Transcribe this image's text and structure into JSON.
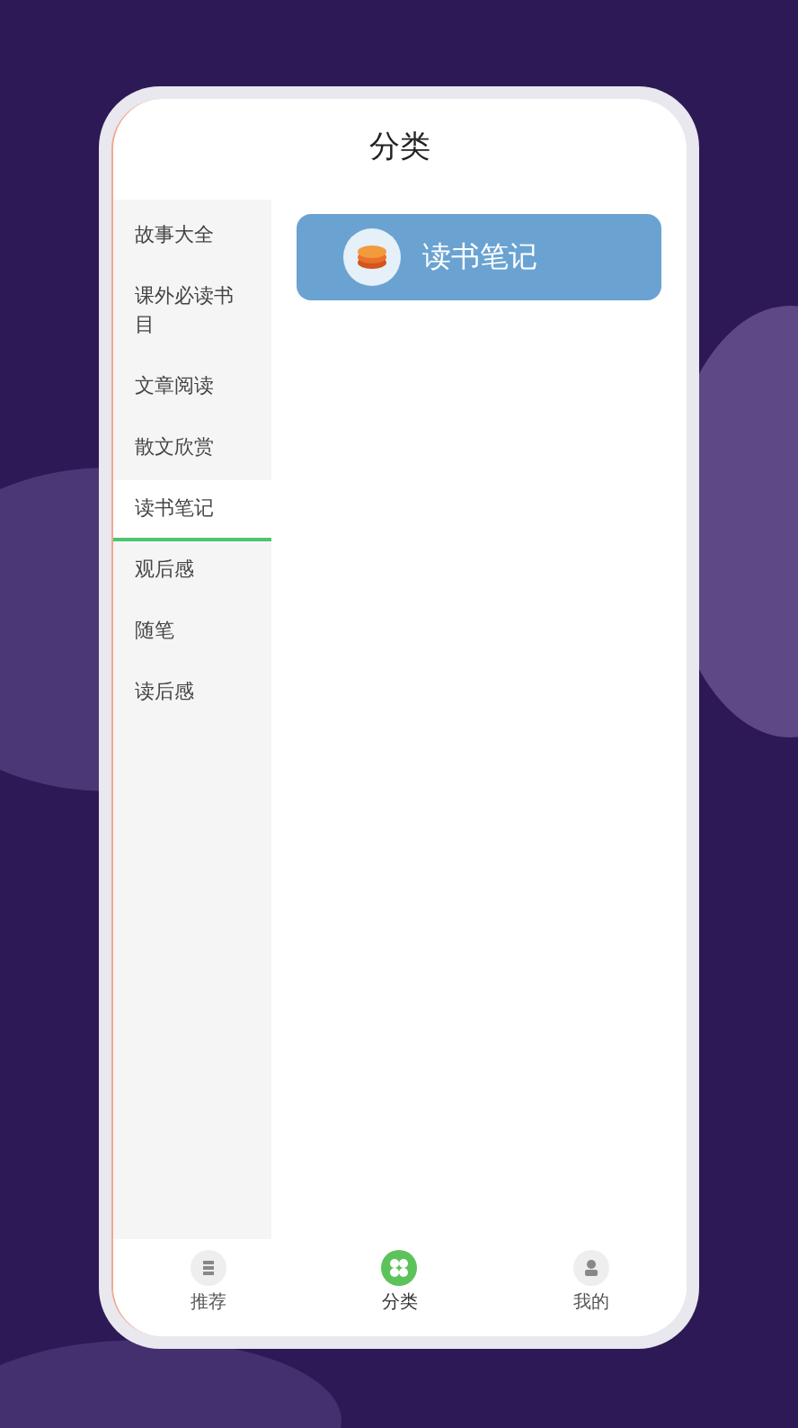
{
  "header": {
    "title": "分类"
  },
  "categories": [
    {
      "label": "故事大全",
      "selected": false
    },
    {
      "label": "课外必读书目",
      "selected": false
    },
    {
      "label": "文章阅读",
      "selected": false
    },
    {
      "label": "散文欣赏",
      "selected": false
    },
    {
      "label": "读书笔记",
      "selected": true
    },
    {
      "label": "观后感",
      "selected": false
    },
    {
      "label": "随笔",
      "selected": false
    },
    {
      "label": "读后感",
      "selected": false
    }
  ],
  "cards": [
    {
      "label": "读书笔记"
    }
  ],
  "tab_bar": [
    {
      "label": "推荐",
      "kind": "book",
      "selected": false
    },
    {
      "label": "分类",
      "kind": "grid",
      "selected": true
    },
    {
      "label": "我的",
      "kind": "person",
      "selected": false
    }
  ]
}
